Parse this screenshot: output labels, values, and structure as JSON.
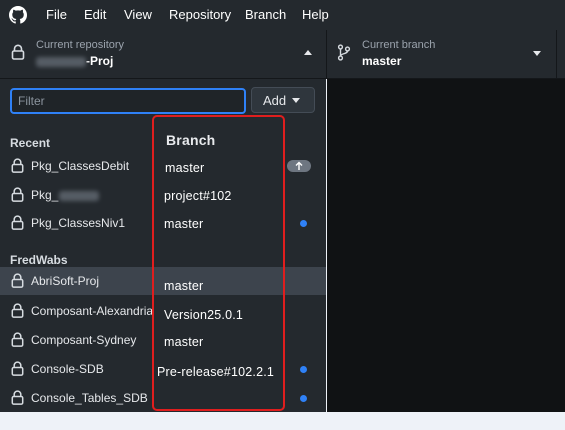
{
  "menu": {
    "items": [
      "File",
      "Edit",
      "View",
      "Repository",
      "Branch",
      "Help"
    ]
  },
  "toolbar": {
    "repository": {
      "label": "Current repository",
      "value_suffix": "-Proj"
    },
    "branch": {
      "label": "Current branch",
      "value": "master"
    }
  },
  "panel": {
    "filter": {
      "placeholder": "Filter",
      "value": ""
    },
    "add_label": "Add",
    "recent_header": "Recent",
    "fredwabs_header": "FredWabs",
    "recent": [
      {
        "name": "Pkg_ClassesDebit",
        "indicator": "push"
      },
      {
        "name": "Pkg_",
        "indicator": "none"
      },
      {
        "name": "Pkg_ClassesNiv1",
        "indicator": "dot"
      }
    ],
    "fredwabs": [
      {
        "name": "AbriSoft-Proj",
        "selected": true,
        "indicator": "none"
      },
      {
        "name": "Composant-Alexandria",
        "indicator": "none"
      },
      {
        "name": "Composant-Sydney",
        "indicator": "none"
      },
      {
        "name": "Console-SDB",
        "indicator": "dot"
      },
      {
        "name": "Console_Tables_SDB",
        "indicator": "dot"
      }
    ]
  },
  "overlay": {
    "header": "Branch",
    "branches": [
      "master",
      "project#102",
      "master",
      "",
      "master",
      "Version25.0.1",
      "master",
      "Pre-release#102.2.1"
    ]
  },
  "colors": {
    "accent": "#2f81f7",
    "annotation": "#e01e1e",
    "panel_bg": "#24292e",
    "selected_row": "#3d444d"
  }
}
